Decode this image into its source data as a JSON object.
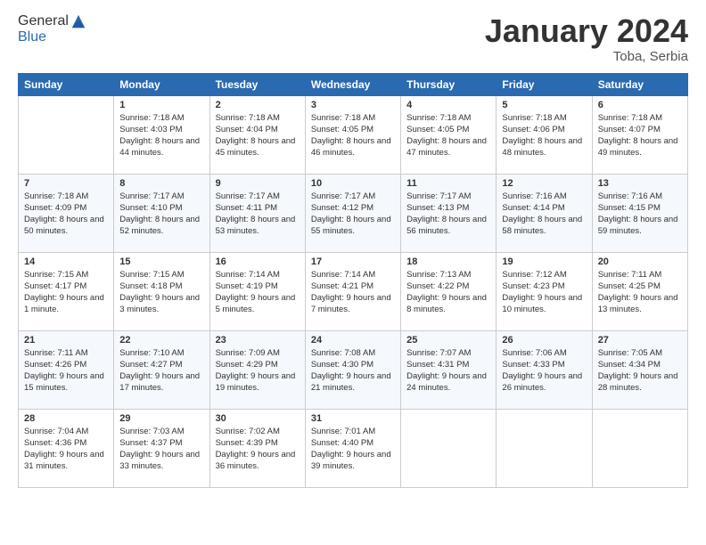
{
  "header": {
    "logo_general": "General",
    "logo_blue": "Blue",
    "month_title": "January 2024",
    "location": "Toba, Serbia"
  },
  "weekdays": [
    "Sunday",
    "Monday",
    "Tuesday",
    "Wednesday",
    "Thursday",
    "Friday",
    "Saturday"
  ],
  "weeks": [
    [
      {
        "day": "",
        "empty": true
      },
      {
        "day": "1",
        "sunrise": "7:18 AM",
        "sunset": "4:03 PM",
        "daylight": "8 hours and 44 minutes."
      },
      {
        "day": "2",
        "sunrise": "7:18 AM",
        "sunset": "4:04 PM",
        "daylight": "8 hours and 45 minutes."
      },
      {
        "day": "3",
        "sunrise": "7:18 AM",
        "sunset": "4:05 PM",
        "daylight": "8 hours and 46 minutes."
      },
      {
        "day": "4",
        "sunrise": "7:18 AM",
        "sunset": "4:05 PM",
        "daylight": "8 hours and 47 minutes."
      },
      {
        "day": "5",
        "sunrise": "7:18 AM",
        "sunset": "4:06 PM",
        "daylight": "8 hours and 48 minutes."
      },
      {
        "day": "6",
        "sunrise": "7:18 AM",
        "sunset": "4:07 PM",
        "daylight": "8 hours and 49 minutes."
      }
    ],
    [
      {
        "day": "7",
        "sunrise": "7:18 AM",
        "sunset": "4:09 PM",
        "daylight": "8 hours and 50 minutes."
      },
      {
        "day": "8",
        "sunrise": "7:17 AM",
        "sunset": "4:10 PM",
        "daylight": "8 hours and 52 minutes."
      },
      {
        "day": "9",
        "sunrise": "7:17 AM",
        "sunset": "4:11 PM",
        "daylight": "8 hours and 53 minutes."
      },
      {
        "day": "10",
        "sunrise": "7:17 AM",
        "sunset": "4:12 PM",
        "daylight": "8 hours and 55 minutes."
      },
      {
        "day": "11",
        "sunrise": "7:17 AM",
        "sunset": "4:13 PM",
        "daylight": "8 hours and 56 minutes."
      },
      {
        "day": "12",
        "sunrise": "7:16 AM",
        "sunset": "4:14 PM",
        "daylight": "8 hours and 58 minutes."
      },
      {
        "day": "13",
        "sunrise": "7:16 AM",
        "sunset": "4:15 PM",
        "daylight": "8 hours and 59 minutes."
      }
    ],
    [
      {
        "day": "14",
        "sunrise": "7:15 AM",
        "sunset": "4:17 PM",
        "daylight": "9 hours and 1 minute."
      },
      {
        "day": "15",
        "sunrise": "7:15 AM",
        "sunset": "4:18 PM",
        "daylight": "9 hours and 3 minutes."
      },
      {
        "day": "16",
        "sunrise": "7:14 AM",
        "sunset": "4:19 PM",
        "daylight": "9 hours and 5 minutes."
      },
      {
        "day": "17",
        "sunrise": "7:14 AM",
        "sunset": "4:21 PM",
        "daylight": "9 hours and 7 minutes."
      },
      {
        "day": "18",
        "sunrise": "7:13 AM",
        "sunset": "4:22 PM",
        "daylight": "9 hours and 8 minutes."
      },
      {
        "day": "19",
        "sunrise": "7:12 AM",
        "sunset": "4:23 PM",
        "daylight": "9 hours and 10 minutes."
      },
      {
        "day": "20",
        "sunrise": "7:11 AM",
        "sunset": "4:25 PM",
        "daylight": "9 hours and 13 minutes."
      }
    ],
    [
      {
        "day": "21",
        "sunrise": "7:11 AM",
        "sunset": "4:26 PM",
        "daylight": "9 hours and 15 minutes."
      },
      {
        "day": "22",
        "sunrise": "7:10 AM",
        "sunset": "4:27 PM",
        "daylight": "9 hours and 17 minutes."
      },
      {
        "day": "23",
        "sunrise": "7:09 AM",
        "sunset": "4:29 PM",
        "daylight": "9 hours and 19 minutes."
      },
      {
        "day": "24",
        "sunrise": "7:08 AM",
        "sunset": "4:30 PM",
        "daylight": "9 hours and 21 minutes."
      },
      {
        "day": "25",
        "sunrise": "7:07 AM",
        "sunset": "4:31 PM",
        "daylight": "9 hours and 24 minutes."
      },
      {
        "day": "26",
        "sunrise": "7:06 AM",
        "sunset": "4:33 PM",
        "daylight": "9 hours and 26 minutes."
      },
      {
        "day": "27",
        "sunrise": "7:05 AM",
        "sunset": "4:34 PM",
        "daylight": "9 hours and 28 minutes."
      }
    ],
    [
      {
        "day": "28",
        "sunrise": "7:04 AM",
        "sunset": "4:36 PM",
        "daylight": "9 hours and 31 minutes."
      },
      {
        "day": "29",
        "sunrise": "7:03 AM",
        "sunset": "4:37 PM",
        "daylight": "9 hours and 33 minutes."
      },
      {
        "day": "30",
        "sunrise": "7:02 AM",
        "sunset": "4:39 PM",
        "daylight": "9 hours and 36 minutes."
      },
      {
        "day": "31",
        "sunrise": "7:01 AM",
        "sunset": "4:40 PM",
        "daylight": "9 hours and 39 minutes."
      },
      {
        "day": "",
        "empty": true
      },
      {
        "day": "",
        "empty": true
      },
      {
        "day": "",
        "empty": true
      }
    ]
  ],
  "labels": {
    "sunrise": "Sunrise:",
    "sunset": "Sunset:",
    "daylight": "Daylight:"
  }
}
